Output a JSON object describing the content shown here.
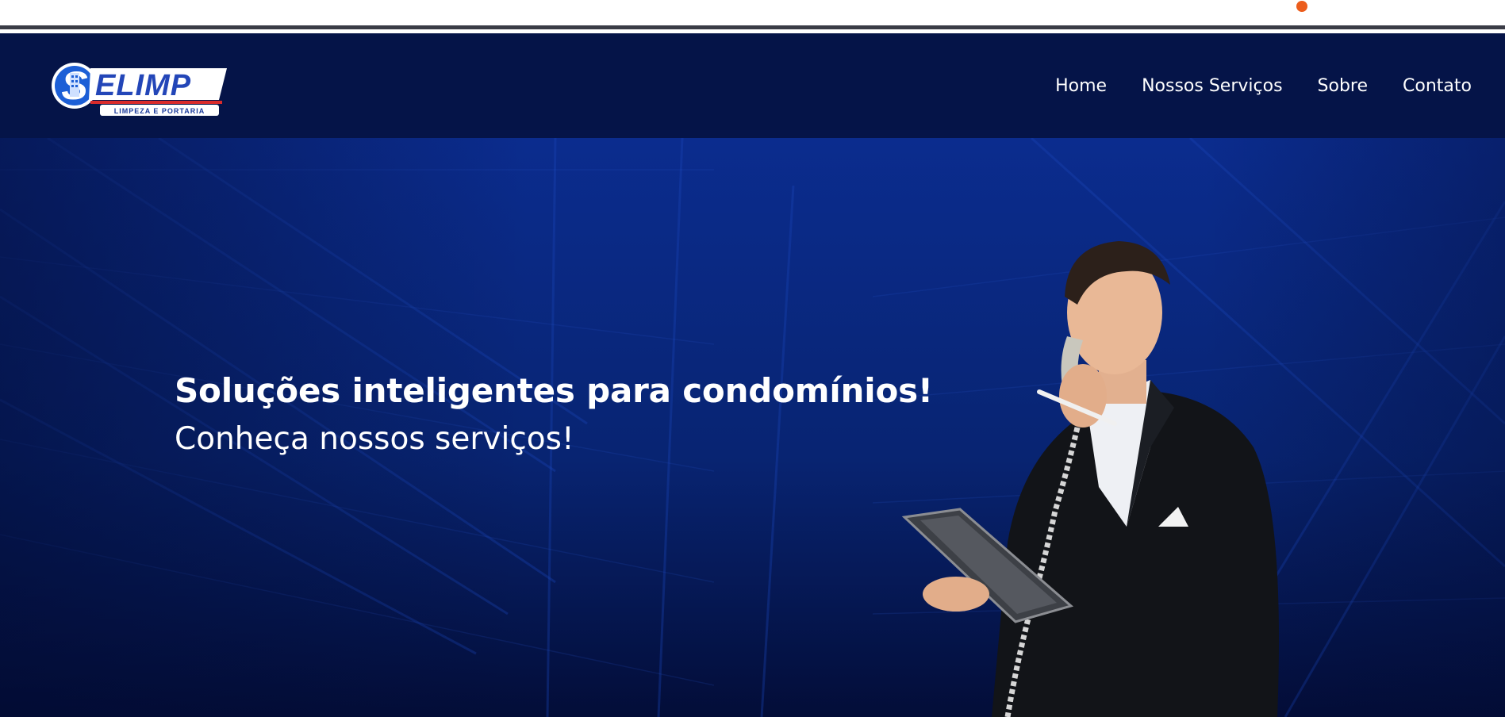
{
  "brand": {
    "logo_text": "ELIMP",
    "logo_letter": "S",
    "logo_tagline": "LIMPEZA E PORTARIA"
  },
  "nav": {
    "items": [
      {
        "label": "Home"
      },
      {
        "label": "Nossos Serviços"
      },
      {
        "label": "Sobre"
      },
      {
        "label": "Contato"
      }
    ]
  },
  "hero": {
    "title": "Soluções inteligentes para condomínios!",
    "subtitle": "Conheça nossos serviços!"
  },
  "colors": {
    "navbar": "#051448",
    "hero": "#0a2a8a",
    "accent_dot": "#ec5d1c"
  }
}
